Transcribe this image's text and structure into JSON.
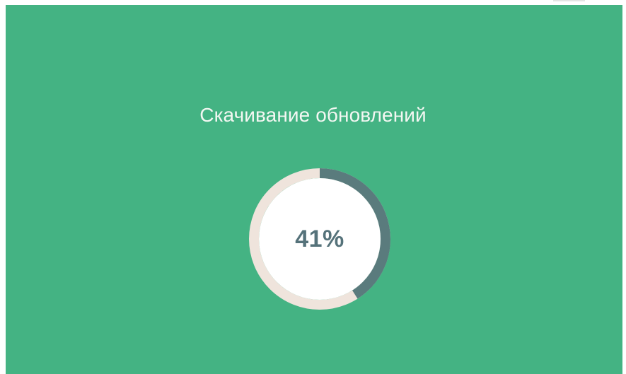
{
  "update": {
    "title": "Скачивание обновлений",
    "progress_text": "41%",
    "progress_fraction": 0.41
  },
  "colors": {
    "panel_background": "#44b383",
    "ring_track": "#efe4dc",
    "ring_fill": "#5a7b7d",
    "center_fill": "#ffffff",
    "percent_text": "#55727a",
    "title_text": "#f3f7f2"
  }
}
